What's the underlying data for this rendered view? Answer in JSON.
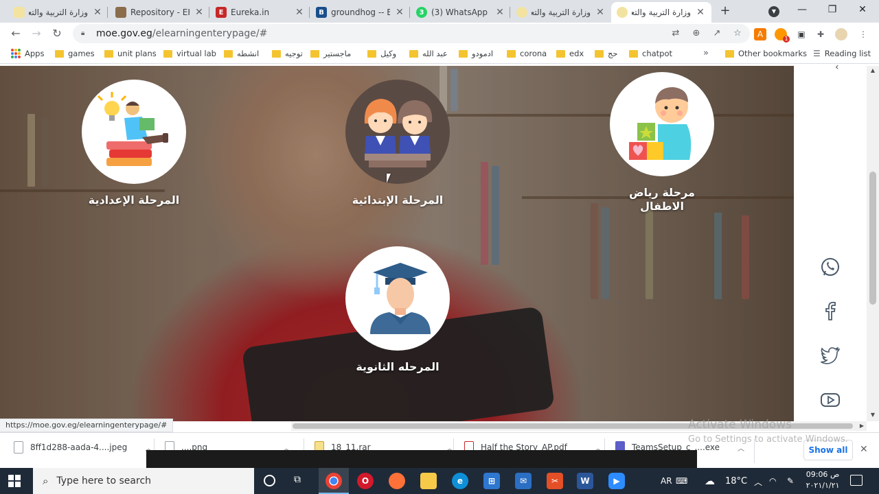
{
  "browser": {
    "tabs": [
      {
        "title": "وزارة التربية والتعليم",
        "favicon": "emoji-face-icon",
        "color": "#f3e3a0",
        "active": false
      },
      {
        "title": "Repository - EKB",
        "favicon": "ekb-icon",
        "color": "#8b6d4b",
        "active": false
      },
      {
        "title": "Eureka.in",
        "favicon": "eureka-icon",
        "color": "#c62828",
        "active": false
      },
      {
        "title": "groundhog -- Brit",
        "favicon": "britannica-icon",
        "color": "#1a4f8b",
        "active": false
      },
      {
        "title": "(3) WhatsApp",
        "favicon": "whatsapp-icon",
        "color": "#25d366",
        "active": false
      },
      {
        "title": "وزارة التربية والتعليم",
        "favicon": "emoji-face-icon",
        "color": "#f3e3a0",
        "active": false
      },
      {
        "title": "وزارة التربية والتعليم",
        "favicon": "emoji-face-icon",
        "color": "#f3e3a0",
        "active": true
      }
    ],
    "whatsapp_badge": "3",
    "url_host": "moe.gov.eg",
    "url_path": "/elearningenterypage/#",
    "status_url": "https://moe.gov.eg/elearningenterypage/#",
    "bookmarks": [
      {
        "label": "Apps",
        "kind": "apps"
      },
      {
        "label": "games",
        "kind": "folder"
      },
      {
        "label": "unit plans",
        "kind": "folder"
      },
      {
        "label": "virtual lab",
        "kind": "folder"
      },
      {
        "label": "انشطه",
        "kind": "folder"
      },
      {
        "label": "توجيه",
        "kind": "folder"
      },
      {
        "label": "ماجستير",
        "kind": "folder"
      },
      {
        "label": "وكيل",
        "kind": "folder"
      },
      {
        "label": "عبد الله",
        "kind": "folder"
      },
      {
        "label": "ادمودو",
        "kind": "folder"
      },
      {
        "label": "corona",
        "kind": "folder"
      },
      {
        "label": "edx",
        "kind": "folder"
      },
      {
        "label": "حج",
        "kind": "folder"
      },
      {
        "label": "chatpot",
        "kind": "folder"
      }
    ],
    "bookmarks_more": "»",
    "other_bookmarks": "Other bookmarks",
    "reading_list": "Reading list",
    "extension_badge": "1"
  },
  "page": {
    "stages": [
      {
        "id": "preparatory",
        "label": "المرحلة الإعدادية",
        "icon": "student-reading-books-icon"
      },
      {
        "id": "primary",
        "label": "المرحلة الإبتدائية",
        "icon": "pupils-at-desk-icon"
      },
      {
        "id": "kindergarten",
        "label": "مرحلة رياض الاطفال",
        "icon": "child-with-blocks-icon"
      },
      {
        "id": "secondary",
        "label": "المرحله الثانوية",
        "icon": "graduate-student-icon"
      }
    ],
    "social": [
      "whatsapp-icon",
      "facebook-icon",
      "twitter-icon",
      "youtube-icon"
    ]
  },
  "downloads": {
    "items": [
      {
        "name": "8ff1d288-aada-4....jpeg"
      },
      {
        "name": "....png"
      },
      {
        "name": "18_11.rar"
      },
      {
        "name": "Half the Story_AP.pdf"
      },
      {
        "name": "TeamsSetup_c_....exe"
      }
    ],
    "show_all": "Show all"
  },
  "watermark": {
    "line1": "Activate Windows",
    "line2": "Go to Settings to activate Windows."
  },
  "taskbar": {
    "search_placeholder": "Type here to search",
    "lang": "AR",
    "temperature": "18°C",
    "time": "09:06 ص",
    "date": "٢٠٢١/١/٢١"
  }
}
